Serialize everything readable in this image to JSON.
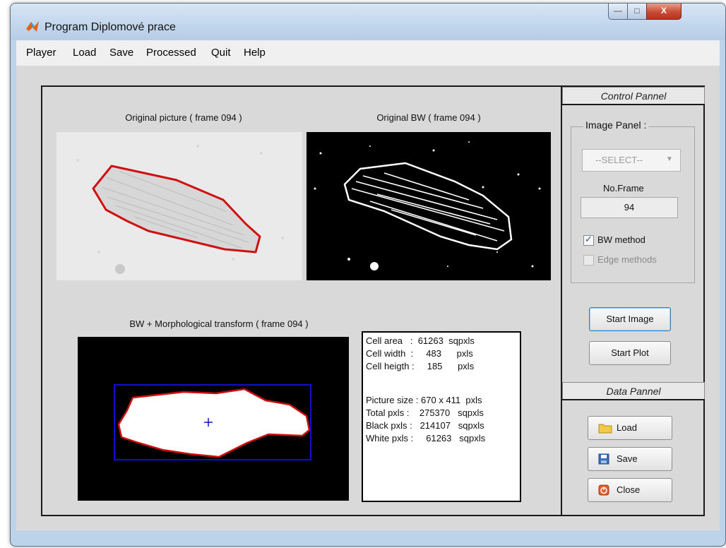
{
  "window": {
    "title": "Program Diplomové prace"
  },
  "menu": [
    "Player",
    "Load",
    "Save",
    "Processed",
    "Quit",
    "Help"
  ],
  "axes": {
    "original": {
      "title": "Original picture ( frame  094 )"
    },
    "original_bw": {
      "title": "Original BW ( frame  094 )"
    },
    "morph": {
      "title": "BW + Morphological transform ( frame  094 )"
    }
  },
  "info_lines": [
    "Cell area   :  61263  sqpxls",
    "Cell width  :     483      pxls",
    "Cell heigth :     185      pxls",
    "",
    "Picture size : 670 x 411  pxls",
    "Total pxls :    275370   sqpxls",
    "Black pxls :   214107   sqpxls",
    "White pxls :     61263   sqpxls"
  ],
  "control_panel": {
    "header": "Control Pannel",
    "image_panel_label": "Image Panel :",
    "select_value": "--SELECT--",
    "no_frame_label": "No.Frame",
    "no_frame_value": "94",
    "bw_method_label": "BW method",
    "bw_method_checked": true,
    "edge_methods_label": "Edge methods",
    "edge_methods_checked": false,
    "start_image_label": "Start Image",
    "start_plot_label": "Start Plot"
  },
  "data_panel": {
    "header": "Data Pannel",
    "load_label": "Load",
    "save_label": "Save",
    "close_label": "Close"
  },
  "colors": {
    "contour": "#d01010",
    "bbox": "#1010c8",
    "frame_bg": "#d9d9d9",
    "title_bar": "#c2d6ec"
  }
}
